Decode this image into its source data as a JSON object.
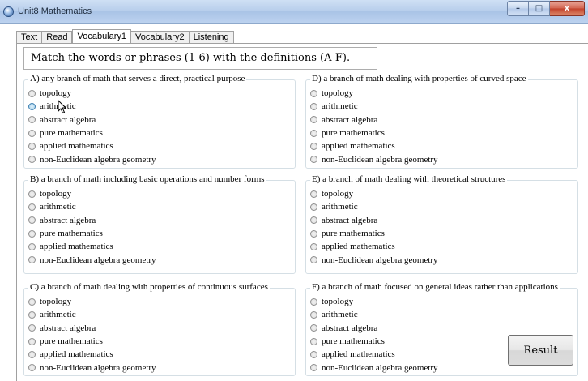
{
  "window": {
    "title": "Unit8 Mathematics",
    "buttons": {
      "minimize": "–",
      "maximize": "□",
      "close": "x"
    }
  },
  "tabs": [
    {
      "label": "Text",
      "active": false
    },
    {
      "label": "Read",
      "active": false
    },
    {
      "label": "Vocabulary1",
      "active": true
    },
    {
      "label": "Vocabulary2",
      "active": false
    },
    {
      "label": "Listening",
      "active": false
    }
  ],
  "instruction": "Match the words or phrases (1-6) with the definitions (A-F).",
  "options": [
    "topology",
    "arithmetic",
    "abstract algebra",
    "pure mathematics",
    "applied mathematics",
    "non-Euclidean algebra geometry"
  ],
  "questions": [
    {
      "title": "A) any branch of math that serves a direct, practical purpose",
      "hovered_option": 1
    },
    {
      "title": "B) a branch of math including basic operations and number forms"
    },
    {
      "title": "C) a branch of math dealing with properties of continuous surfaces"
    },
    {
      "title": "D) a branch of math dealing with properties of curved space"
    },
    {
      "title": "E) a branch of math dealing with theoretical structures"
    },
    {
      "title": "F) a branch of math focused on general ideas rather than applications"
    }
  ],
  "result_button": "Result"
}
